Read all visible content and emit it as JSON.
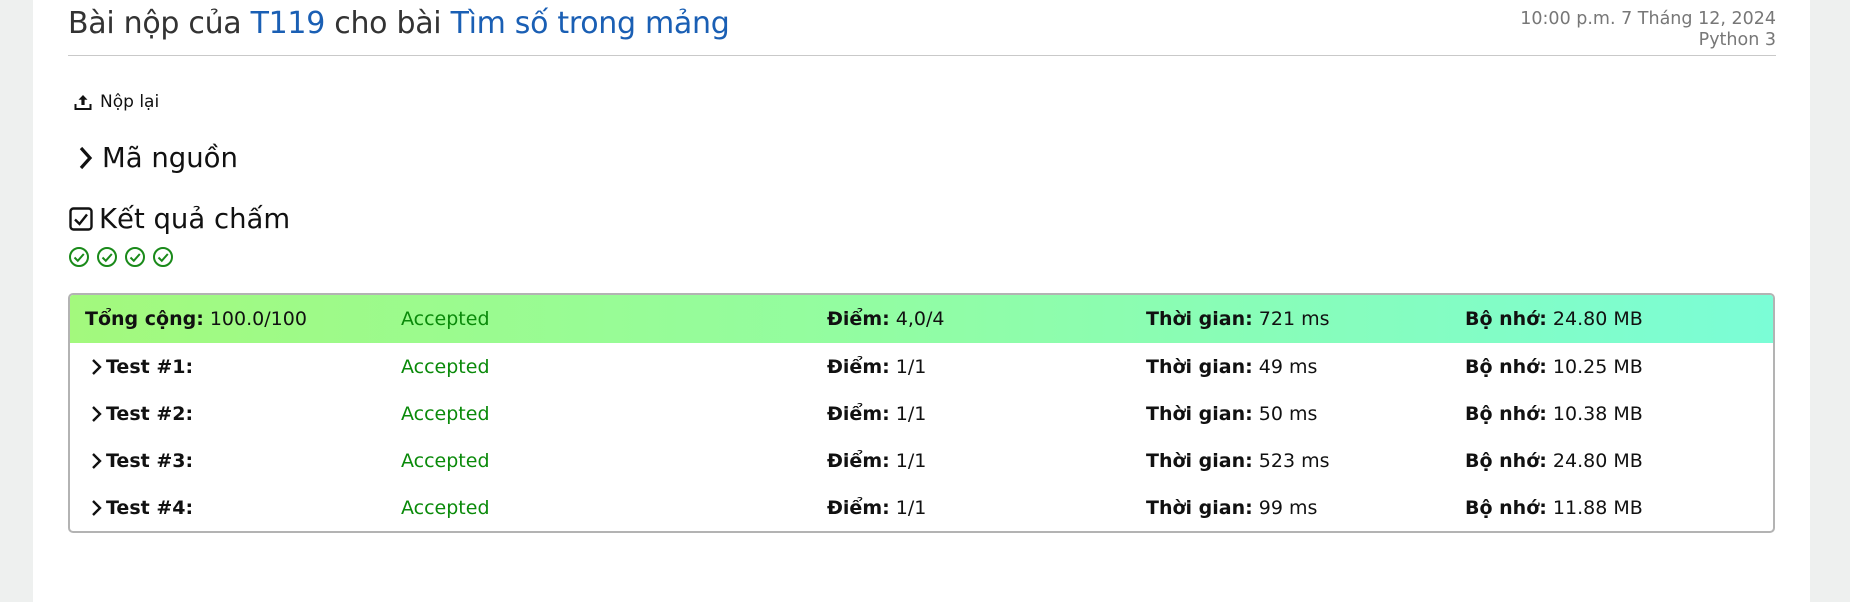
{
  "header": {
    "title_prefix": "Bài nộp của",
    "user": "T119",
    "title_middle": "cho bài",
    "problem": "Tìm số trong mảng",
    "datetime": "10:00 p.m. 7 Tháng 12, 2024",
    "language": "Python 3"
  },
  "actions": {
    "resubmit_label": "Nộp lại"
  },
  "source_section": {
    "label": "Mã nguồn"
  },
  "results_section": {
    "label": "Kết quả chấm"
  },
  "status_icons": [
    "check-circle-icon",
    "check-circle-icon",
    "check-circle-icon",
    "check-circle-icon"
  ],
  "colors": {
    "accepted": "#0a8a0a",
    "link": "#1a5fb4",
    "check": "#1a8a1a"
  },
  "labels": {
    "score": "Điểm:",
    "time": "Thời gian:",
    "memory": "Bộ nhớ:"
  },
  "total": {
    "label": "Tổng cộng:",
    "points": "100.0/100",
    "status": "Accepted",
    "score": "4,0/4",
    "time": "721 ms",
    "memory": "24.80 MB"
  },
  "tests": [
    {
      "label": "Test #1:",
      "status": "Accepted",
      "score": "1/1",
      "time": "49 ms",
      "memory": "10.25 MB"
    },
    {
      "label": "Test #2:",
      "status": "Accepted",
      "score": "1/1",
      "time": "50 ms",
      "memory": "10.38 MB"
    },
    {
      "label": "Test #3:",
      "status": "Accepted",
      "score": "1/1",
      "time": "523 ms",
      "memory": "24.80 MB"
    },
    {
      "label": "Test #4:",
      "status": "Accepted",
      "score": "1/1",
      "time": "99 ms",
      "memory": "11.88 MB"
    }
  ]
}
